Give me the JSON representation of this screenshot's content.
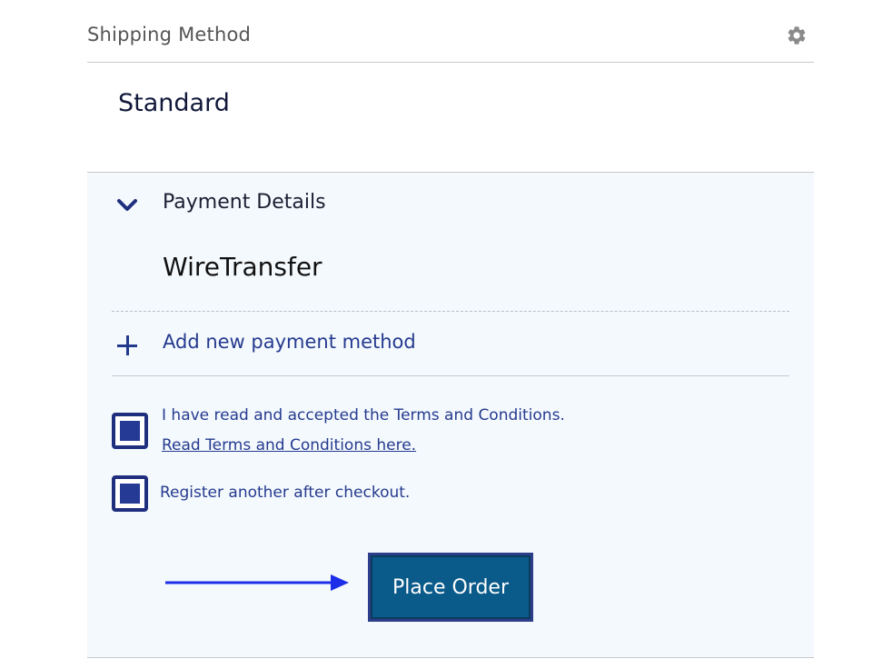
{
  "shipping": {
    "title": "Shipping Method",
    "value": "Standard",
    "settings_icon": "gear-icon"
  },
  "payment": {
    "title": "Payment Details",
    "expand_icon": "chevron-down-icon",
    "value": "WireTransfer",
    "add_label": "Add new payment method",
    "add_icon": "plus-icon"
  },
  "terms": {
    "text": "I have read and accepted the Terms and Conditions.",
    "link": "Read Terms and Conditions here.",
    "checked": true
  },
  "register": {
    "text": "Register another after checkout.",
    "checked": true
  },
  "place_order": {
    "label": "Place Order"
  },
  "colors": {
    "accent_blue": "#253a8f",
    "button_fill": "#0a5a8a",
    "panel_bg": "#f4f9fd",
    "arrow": "#1d2ee8"
  }
}
